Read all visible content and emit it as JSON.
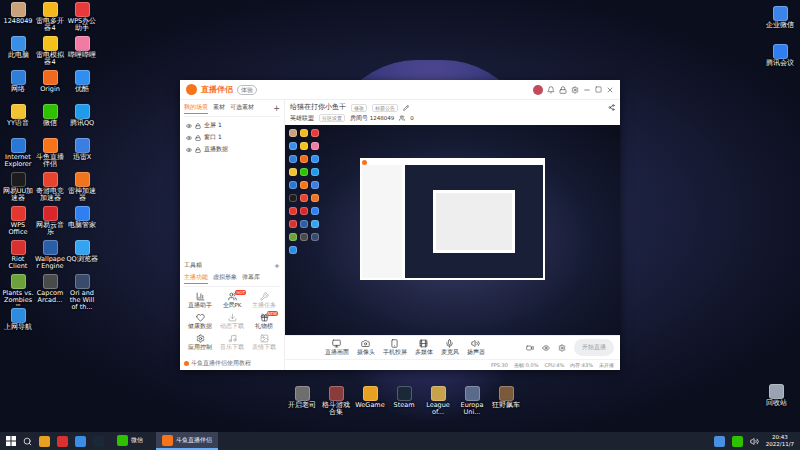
{
  "desktop": {
    "left_icon_columns": [
      [
        {
          "label": "1248049",
          "color": "#c9a27a"
        },
        {
          "label": "此电脑",
          "color": "#3a8ee6"
        },
        {
          "label": "网络",
          "color": "#2f7fd8"
        },
        {
          "label": "YY语音",
          "color": "#f2c230"
        },
        {
          "label": "Internet Explorer",
          "color": "#2a78d6"
        },
        {
          "label": "网易UU加速器",
          "color": "#1c1c1c"
        },
        {
          "label": "WPS Office",
          "color": "#e2362e"
        },
        {
          "label": "Riot Client",
          "color": "#d8312f"
        },
        {
          "label": "Plants vs. Zombies™",
          "color": "#6ba33a"
        },
        {
          "label": "上网导航",
          "color": "#2d8be0"
        }
      ],
      [
        {
          "label": "雷电多开器4",
          "color": "#f5b81c"
        },
        {
          "label": "雷电模拟器4",
          "color": "#f5c21c"
        },
        {
          "label": "Origin",
          "color": "#f06a1d"
        },
        {
          "label": "微信",
          "color": "#2dc100"
        },
        {
          "label": "斗鱼直播伴侣",
          "color": "#f7741b"
        },
        {
          "label": "奇游电竞加速器",
          "color": "#e8432f"
        },
        {
          "label": "网易云音乐",
          "color": "#d9262b"
        },
        {
          "label": "Wallpaper Engine",
          "color": "#2a5fa8"
        },
        {
          "label": "Capcom Arcad...",
          "color": "#4a4a4a"
        }
      ],
      [
        {
          "label": "WPS办公助手",
          "color": "#e83a3a"
        },
        {
          "label": "哔哩哔哩",
          "color": "#f27ba3"
        },
        {
          "label": "优酷",
          "color": "#2f8ef0"
        },
        {
          "label": "腾讯QQ",
          "color": "#1f9bea"
        },
        {
          "label": "迅雷X",
          "color": "#3b7de0"
        },
        {
          "label": "雷神加速器",
          "color": "#f0741c"
        },
        {
          "label": "电脑管家",
          "color": "#2f7ff0"
        },
        {
          "label": "QQ浏览器",
          "color": "#35a4f0"
        },
        {
          "label": "Ori and the Will of th...",
          "color": "#3a4a6a"
        }
      ]
    ],
    "right_icons": [
      {
        "label": "企业微信",
        "color": "#3d84e8"
      },
      {
        "label": "腾讯会议",
        "color": "#2f7ff0"
      }
    ],
    "recycle_bin": {
      "label": "回收站",
      "color": "#9aa4b0"
    },
    "bottom_icons": [
      {
        "label": "开启老司",
        "color": "#6e6e6e"
      },
      {
        "label": "格斗游戏合集",
        "color": "#8a3b3b"
      },
      {
        "label": "WeGame",
        "color": "#e8a020"
      },
      {
        "label": "Steam",
        "color": "#1b2838"
      },
      {
        "label": "League of...",
        "color": "#c8a24a"
      },
      {
        "label": "Europa Uni...",
        "color": "#5a6a8a"
      },
      {
        "label": "狂野飙车",
        "color": "#7a5a3a"
      }
    ]
  },
  "window": {
    "title": "直播伴侣",
    "badge": "体验",
    "scene_tabs": [
      {
        "label": "我的场景",
        "selected": true
      },
      {
        "label": "素材",
        "selected": false
      },
      {
        "label": "可选素材",
        "selected": false
      }
    ],
    "add_tab": "+",
    "sources": [
      {
        "label": "全屏 1"
      },
      {
        "label": "窗口 1"
      },
      {
        "label": "直播数据"
      }
    ],
    "toolbox": {
      "title": "工具箱",
      "tabs": [
        {
          "label": "主播功能",
          "selected": true
        },
        {
          "label": "虚拟形象",
          "selected": false
        },
        {
          "label": "弹幕库",
          "selected": false
        }
      ],
      "tools": [
        {
          "label": "直播助手",
          "badge": "",
          "disabled": false
        },
        {
          "label": "全民PK",
          "badge": "HOT",
          "disabled": false
        },
        {
          "label": "主播任务",
          "badge": "",
          "disabled": true
        },
        {
          "label": "健康数据",
          "badge": "",
          "disabled": false
        },
        {
          "label": "动态下载",
          "badge": "",
          "disabled": true
        },
        {
          "label": "礼物榜",
          "badge": "NEW",
          "disabled": false
        },
        {
          "label": "应用控制",
          "badge": "",
          "disabled": false
        },
        {
          "label": "音乐下载",
          "badge": "",
          "disabled": true
        },
        {
          "label": "表情下载",
          "badge": "",
          "disabled": true
        }
      ]
    },
    "tutorial": "斗鱼直播伴侣使用教程",
    "room": {
      "title": "给猫在打你小鱼干",
      "edit": "修改",
      "notice": "标题公告",
      "category_label": "英雄联盟",
      "category_edit": "分区设置",
      "room_label": "房间号",
      "room_id": "1248049",
      "fans": "0"
    },
    "controls": [
      {
        "label": "直播画面"
      },
      {
        "label": "摄像头"
      },
      {
        "label": "手机投屏"
      },
      {
        "label": "多媒体"
      },
      {
        "label": "麦克风"
      },
      {
        "label": "扬声器"
      }
    ],
    "start_button": {
      "label": "开始直播",
      "disabled": true
    },
    "status": [
      "FPS:30",
      "丢帧:0.0%",
      "CPU:4%",
      "内存:43%",
      "未开播"
    ]
  },
  "taskbar": {
    "apps": [
      {
        "label": "微信",
        "selected": false
      },
      {
        "label": "斗鱼直播伴侣",
        "selected": true
      }
    ],
    "time": "20:43",
    "date": "2022/11/7"
  }
}
